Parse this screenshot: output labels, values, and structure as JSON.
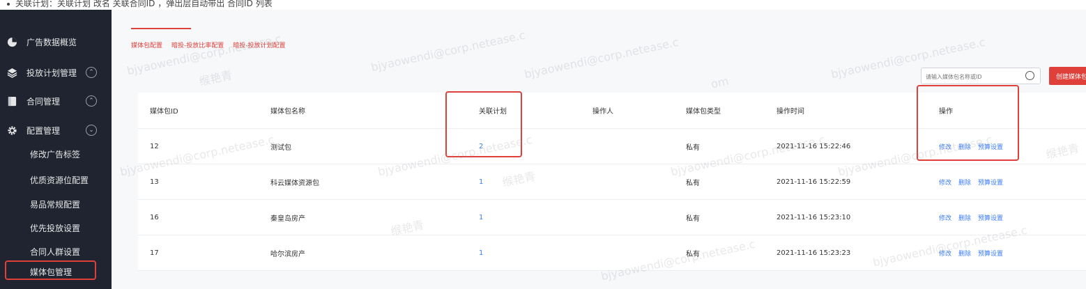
{
  "top_note": "关联计划：关联计划 改名 关联合同ID ，弹出层自动带出 合同ID 列表",
  "sidebar": {
    "items": [
      {
        "label": "广告数据概览",
        "icon": "dashboard-icon"
      },
      {
        "label": "投放计划管理",
        "icon": "layers-icon",
        "chevron": "⌃"
      },
      {
        "label": "合同管理",
        "icon": "contract-icon",
        "chevron": "⌃"
      },
      {
        "label": "配置管理",
        "icon": "gear-icon",
        "chevron": "⌄"
      }
    ],
    "sub_items": [
      "修改广告标签",
      "优质资源位配置",
      "易品常规配置",
      "优先投放设置",
      "合同人群设置",
      "媒体包管理"
    ]
  },
  "tabs": [
    "媒体包配置",
    "暗投-投放比率配置",
    "暗投-投放计划配置"
  ],
  "search": {
    "placeholder": "请输入媒体包名称或ID"
  },
  "create_button": "创建媒体包",
  "table": {
    "headers": [
      "媒体包ID",
      "媒体包名称",
      "关联计划",
      "操作人",
      "媒体包类型",
      "操作时间",
      "操作"
    ],
    "rows": [
      {
        "id": "12",
        "name": "测试包",
        "plans": "2",
        "operator": "",
        "type": "私有",
        "time": "2021-11-16 15:22:46"
      },
      {
        "id": "13",
        "name": "科云媒体资源包",
        "plans": "1",
        "operator": "",
        "type": "私有",
        "time": "2021-11-16 15:22:59"
      },
      {
        "id": "16",
        "name": "秦皇岛房产",
        "plans": "1",
        "operator": "",
        "type": "私有",
        "time": "2021-11-16 15:23:10"
      },
      {
        "id": "17",
        "name": "哈尔滨房产",
        "plans": "1",
        "operator": "",
        "type": "私有",
        "time": "2021-11-16 15:23:23"
      }
    ],
    "actions": [
      "修改",
      "删除",
      "预算设置"
    ]
  },
  "watermark": [
    "bjyaowendi@corp.netease.c",
    "缑艳青",
    "om"
  ],
  "colors": {
    "accent": "#e0403a",
    "link": "#3b7cf5",
    "sidebar": "#1f2430"
  }
}
